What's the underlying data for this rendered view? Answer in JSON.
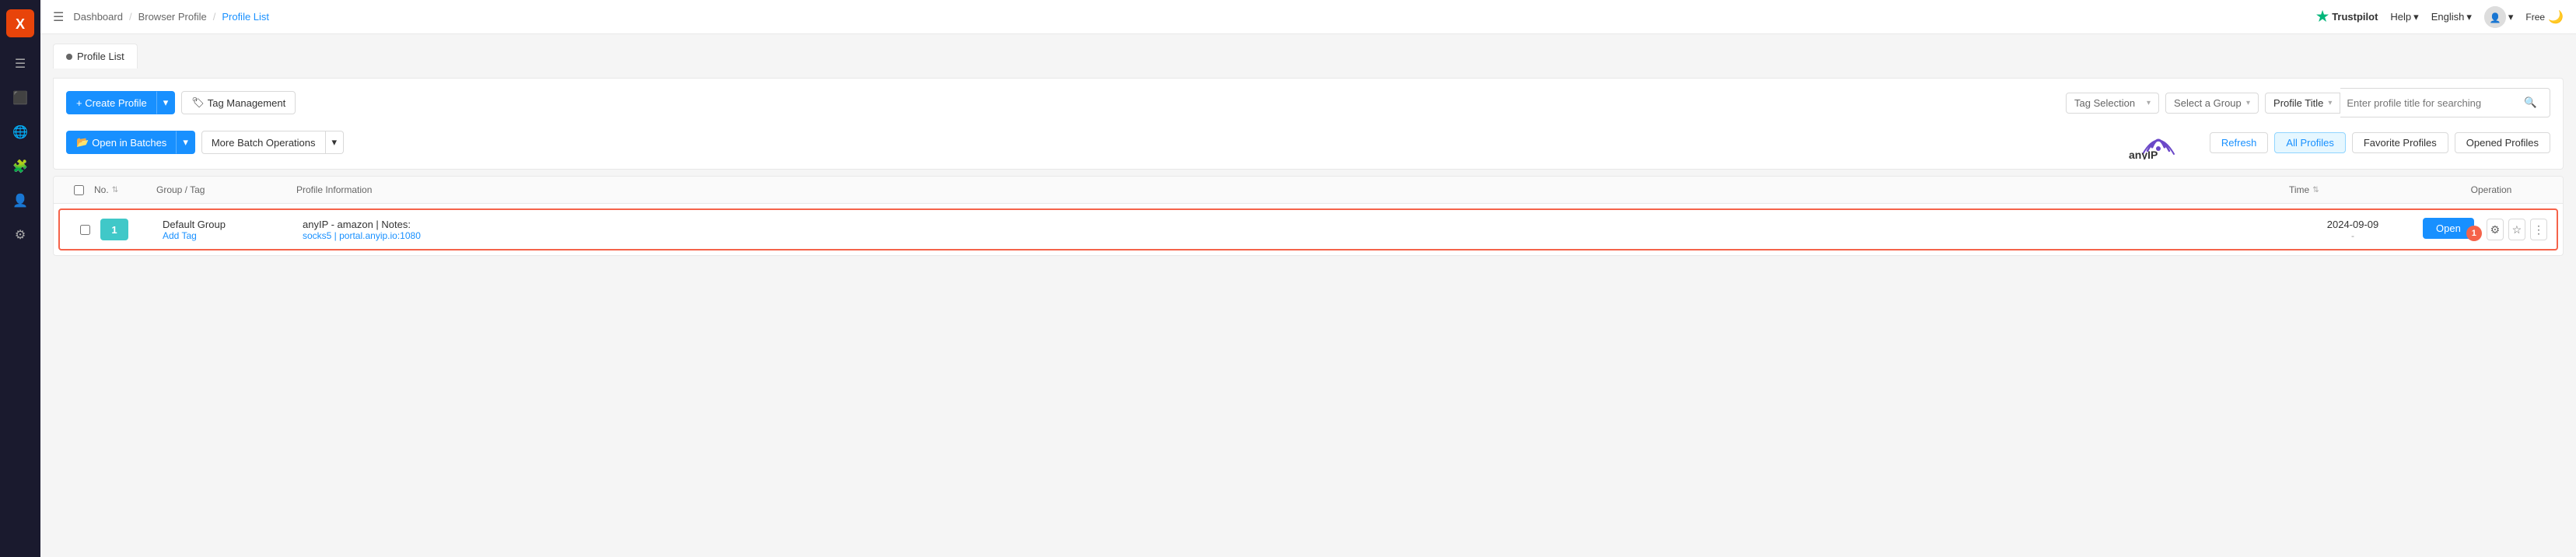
{
  "sidebar": {
    "logo_text": "X",
    "icons": [
      "≡",
      "⬜",
      "🌐",
      "🧩",
      "👤",
      "⚙"
    ]
  },
  "topnav": {
    "menu_icon": "☰",
    "breadcrumbs": [
      "Dashboard",
      "Browser Profile",
      "Profile List"
    ],
    "trustpilot_label": "Trustpilot",
    "help_label": "Help",
    "language_label": "English",
    "free_label": "Free",
    "moon_icon": "🌙"
  },
  "page": {
    "title": "Profile List",
    "title_dot": "●"
  },
  "toolbar": {
    "create_profile_label": "+ Create Profile",
    "tag_management_label": "Tag Management",
    "open_in_batches_label": "Open in Batches",
    "more_batch_ops_label": "More Batch Operations",
    "tag_selection_placeholder": "Tag Selection",
    "select_group_placeholder": "Select a Group",
    "profile_title_label": "Profile Title",
    "search_placeholder": "Enter profile title for searching",
    "refresh_label": "Refresh",
    "all_profiles_label": "All Profiles",
    "favorite_profiles_label": "Favorite Profiles",
    "opened_profiles_label": "Opened Profiles"
  },
  "table": {
    "headers": {
      "no": "No.",
      "group_tag": "Group / Tag",
      "profile_info": "Profile Information",
      "time": "Time",
      "operation": "Operation"
    },
    "rows": [
      {
        "id": 1,
        "num_badge": "1",
        "group": "Default Group",
        "add_tag": "Add Tag",
        "title": "anyIP - amazon | Notes:",
        "subtitle": "socks5  |  portal.anyip.io:1080",
        "time": "2024-09-09",
        "time2": "-",
        "open_label": "Open",
        "badge_count": "1"
      }
    ]
  },
  "anyip": {
    "alt": "anyIP logo"
  }
}
